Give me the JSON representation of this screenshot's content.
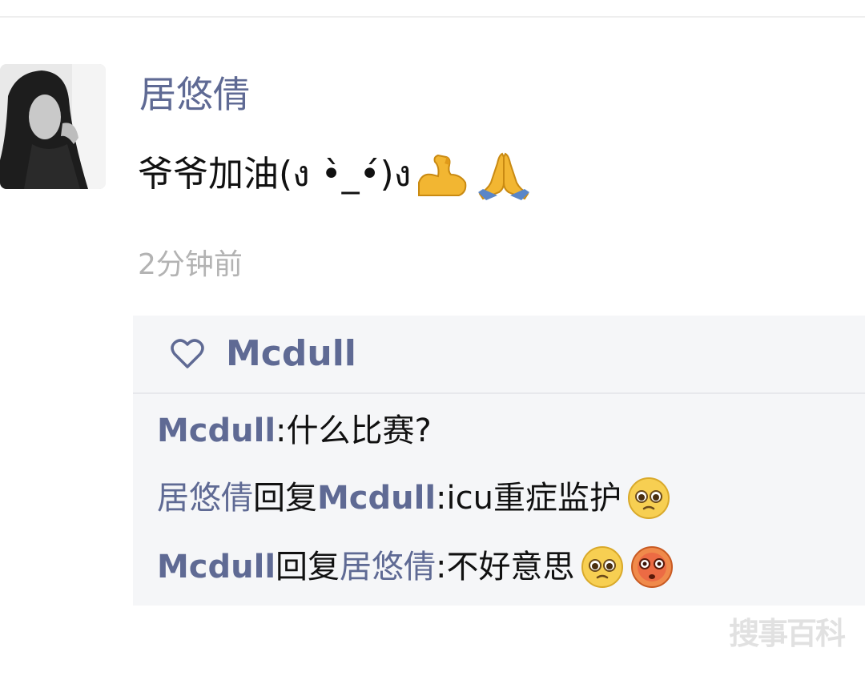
{
  "post": {
    "author": "居悠倩",
    "text": "爷爷加油(ง •̀_•́)ง",
    "emoji_icons": [
      "flexed-biceps-icon",
      "folded-hands-icon"
    ],
    "timestamp": "2分钟前"
  },
  "likes": {
    "icon": "heart-outline-icon",
    "names": "Mcdull"
  },
  "comments": [
    {
      "author": "Mcdull",
      "reply_word": "",
      "target": "",
      "separator": ": ",
      "text": "什么比赛?",
      "emojis": []
    },
    {
      "author": "居悠倩",
      "reply_word": "回复",
      "target": "Mcdull",
      "separator": ": ",
      "text": "icu重症监护",
      "emojis": [
        "pleading-face-icon"
      ]
    },
    {
      "author": "Mcdull",
      "reply_word": "回复",
      "target": "居悠倩",
      "separator": ": ",
      "text": "不好意思",
      "emojis": [
        "pleading-face-icon",
        "flushed-face-icon"
      ]
    }
  ],
  "watermark": "搜事百科",
  "colors": {
    "name": "#5f6a94",
    "text": "#111111",
    "timestamp": "#b3b3b3",
    "comment_bg": "#f5f6f8"
  }
}
